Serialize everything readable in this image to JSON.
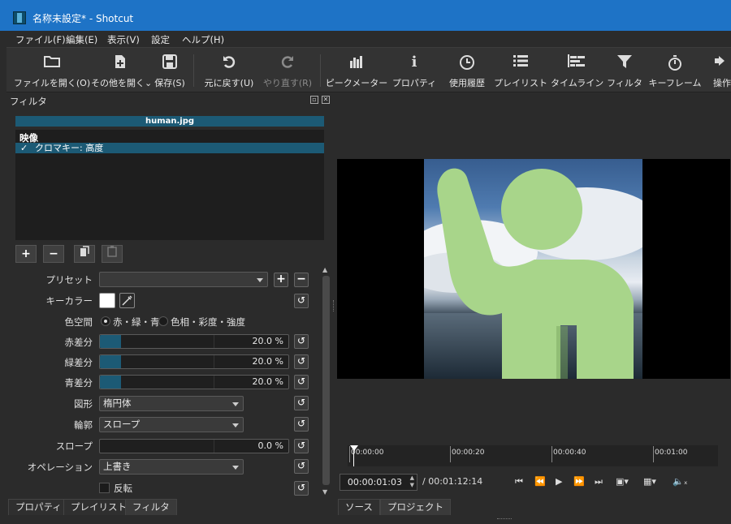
{
  "window": {
    "title": "名称未設定* - Shotcut"
  },
  "menu": [
    "ファイル(F)",
    "編集(E)",
    "表示(V)",
    "設定",
    "ヘルプ(H)"
  ],
  "toolbar": [
    {
      "label": "ファイルを開く(O)",
      "icon": "folder-open-icon",
      "glyph": "▭"
    },
    {
      "label": "その他を開く",
      "icon": "open-other-icon",
      "glyph": "✚"
    },
    {
      "label": "保存(S)",
      "icon": "save-icon",
      "glyph": "▣"
    },
    {
      "label": "元に戻す(U)",
      "icon": "undo-icon",
      "glyph": "↶"
    },
    {
      "label": "やり直す(R)",
      "icon": "redo-icon",
      "glyph": "↷"
    },
    {
      "label": "ピークメーター",
      "icon": "peak-meter-icon",
      "glyph": "▥"
    },
    {
      "label": "プロパティ",
      "icon": "info-icon",
      "glyph": "ℹ"
    },
    {
      "label": "使用履歴",
      "icon": "clock-icon",
      "glyph": "◷"
    },
    {
      "label": "プレイリスト",
      "icon": "list-icon",
      "glyph": "☰"
    },
    {
      "label": "タイムライン",
      "icon": "timeline-icon",
      "glyph": "☷"
    },
    {
      "label": "フィルタ",
      "icon": "filter-icon",
      "glyph": "▼"
    },
    {
      "label": "キーフレーム",
      "icon": "stopwatch-icon",
      "glyph": "⏱"
    },
    {
      "label": "操作",
      "icon": "overflow-icon",
      "glyph": "◂"
    }
  ],
  "filter_panel": {
    "title": "フィルタ",
    "clip_name": "human.jpg",
    "category": "映像",
    "filter_item": "クロマキー: 高度",
    "check": "✓"
  },
  "props": {
    "preset_label": "プリセット",
    "preset_value": "",
    "keycolor_label": "キーカラー",
    "colorspace_label": "色空間",
    "colorspace_opt1": "赤・緑・青",
    "colorspace_opt2": "色相・彩度・強度",
    "red_label": "赤差分",
    "red_value": "20.0 %",
    "red_fraction": 0.2,
    "green_label": "緑差分",
    "green_value": "20.0 %",
    "green_fraction": 0.2,
    "blue_label": "青差分",
    "blue_value": "20.0 %",
    "blue_fraction": 0.2,
    "shape_label": "図形",
    "shape_value": "楕円体",
    "edge_label": "輪郭",
    "edge_value": "スロープ",
    "slope_label": "スロープ",
    "slope_value": "0.0 %",
    "slope_fraction": 0.0,
    "operation_label": "オペレーション",
    "operation_value": "上書き",
    "invert_label": "反転"
  },
  "left_tabs": [
    "プロパティ",
    "プレイリスト",
    "フィルタ"
  ],
  "player": {
    "ticks": [
      "00:00:00",
      "00:00:20",
      "00:00:40",
      "00:01:00"
    ],
    "current_time": "00:00:01:03",
    "duration": "/ 00:01:12:14"
  },
  "player_tabs": [
    "ソース",
    "プロジェクト"
  ],
  "colors": {
    "accent": "#1c5a75",
    "title_bar": "#1e73c6",
    "figure": "#a8d58a"
  }
}
